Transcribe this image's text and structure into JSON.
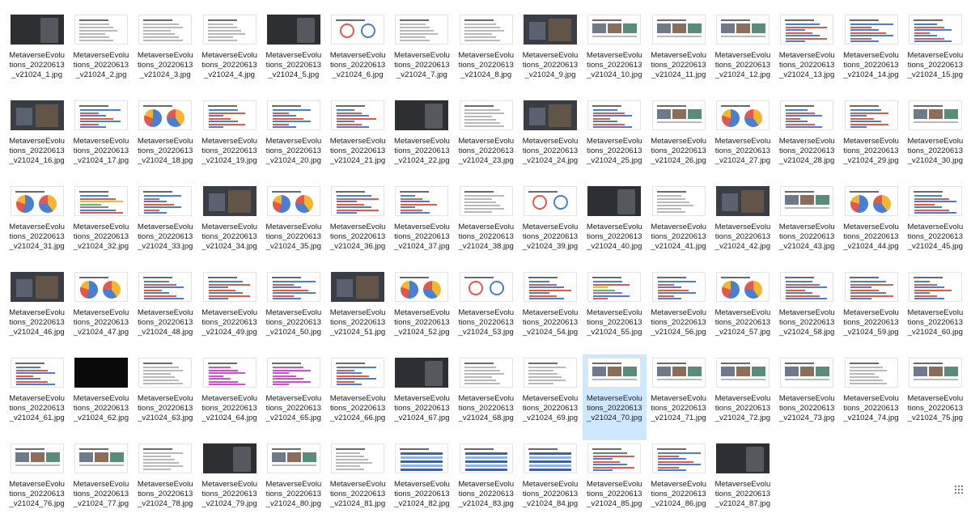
{
  "files": [
    {
      "name": "MetaverseEvolutions_20220613_v21024_1.jpg",
      "style": "dark"
    },
    {
      "name": "MetaverseEvolutions_20220613_v21024_2.jpg",
      "style": "text"
    },
    {
      "name": "MetaverseEvolutions_20220613_v21024_3.jpg",
      "style": "text"
    },
    {
      "name": "MetaverseEvolutions_20220613_v21024_4.jpg",
      "style": "text"
    },
    {
      "name": "MetaverseEvolutions_20220613_v21024_5.jpg",
      "style": "dark"
    },
    {
      "name": "MetaverseEvolutions_20220613_v21024_6.jpg",
      "style": "circles"
    },
    {
      "name": "MetaverseEvolutions_20220613_v21024_7.jpg",
      "style": "text"
    },
    {
      "name": "MetaverseEvolutions_20220613_v21024_8.jpg",
      "style": "text"
    },
    {
      "name": "MetaverseEvolutions_20220613_v21024_9.jpg",
      "style": "photo"
    },
    {
      "name": "MetaverseEvolutions_20220613_v21024_10.jpg",
      "style": "collage"
    },
    {
      "name": "MetaverseEvolutions_20220613_v21024_11.jpg",
      "style": "collage"
    },
    {
      "name": "MetaverseEvolutions_20220613_v21024_12.jpg",
      "style": "collage"
    },
    {
      "name": "MetaverseEvolutions_20220613_v21024_13.jpg",
      "style": "bars"
    },
    {
      "name": "MetaverseEvolutions_20220613_v21024_14.jpg",
      "style": "bars"
    },
    {
      "name": "MetaverseEvolutions_20220613_v21024_15.jpg",
      "style": "bars"
    },
    {
      "name": "MetaverseEvolutions_20220613_v21024_16.jpg",
      "style": "photo"
    },
    {
      "name": "MetaverseEvolutions_20220613_v21024_17.jpg",
      "style": "bars"
    },
    {
      "name": "MetaverseEvolutions_20220613_v21024_18.jpg",
      "style": "pies"
    },
    {
      "name": "MetaverseEvolutions_20220613_v21024_19.jpg",
      "style": "bars"
    },
    {
      "name": "MetaverseEvolutions_20220613_v21024_20.jpg",
      "style": "bars"
    },
    {
      "name": "MetaverseEvolutions_20220613_v21024_21.jpg",
      "style": "bars"
    },
    {
      "name": "MetaverseEvolutions_20220613_v21024_22.jpg",
      "style": "dark"
    },
    {
      "name": "MetaverseEvolutions_20220613_v21024_23.jpg",
      "style": "text"
    },
    {
      "name": "MetaverseEvolutions_20220613_v21024_24.jpg",
      "style": "photo"
    },
    {
      "name": "MetaverseEvolutions_20220613_v21024_25.jpg",
      "style": "bars"
    },
    {
      "name": "MetaverseEvolutions_20220613_v21024_26.jpg",
      "style": "collage"
    },
    {
      "name": "MetaverseEvolutions_20220613_v21024_27.jpg",
      "style": "pies"
    },
    {
      "name": "MetaverseEvolutions_20220613_v21024_28.jpg",
      "style": "bars"
    },
    {
      "name": "MetaverseEvolutions_20220613_v21024_29.jpg",
      "style": "bars"
    },
    {
      "name": "MetaverseEvolutions_20220613_v21024_30.jpg",
      "style": "collage"
    },
    {
      "name": "MetaverseEvolutions_20220613_v21024_31.jpg",
      "style": "pies"
    },
    {
      "name": "MetaverseEvolutions_20220613_v21024_32.jpg",
      "style": "colorbars"
    },
    {
      "name": "MetaverseEvolutions_20220613_v21024_33.jpg",
      "style": "bars"
    },
    {
      "name": "MetaverseEvolutions_20220613_v21024_34.jpg",
      "style": "photo"
    },
    {
      "name": "MetaverseEvolutions_20220613_v21024_35.jpg",
      "style": "pies"
    },
    {
      "name": "MetaverseEvolutions_20220613_v21024_36.jpg",
      "style": "bars"
    },
    {
      "name": "MetaverseEvolutions_20220613_v21024_37.jpg",
      "style": "bars"
    },
    {
      "name": "MetaverseEvolutions_20220613_v21024_38.jpg",
      "style": "text"
    },
    {
      "name": "MetaverseEvolutions_20220613_v21024_39.jpg",
      "style": "circles"
    },
    {
      "name": "MetaverseEvolutions_20220613_v21024_40.jpg",
      "style": "dark"
    },
    {
      "name": "MetaverseEvolutions_20220613_v21024_41.jpg",
      "style": "text"
    },
    {
      "name": "MetaverseEvolutions_20220613_v21024_42.jpg",
      "style": "photo"
    },
    {
      "name": "MetaverseEvolutions_20220613_v21024_43.jpg",
      "style": "collage"
    },
    {
      "name": "MetaverseEvolutions_20220613_v21024_44.jpg",
      "style": "pies"
    },
    {
      "name": "MetaverseEvolutions_20220613_v21024_45.jpg",
      "style": "bars"
    },
    {
      "name": "MetaverseEvolutions_20220613_v21024_46.jpg",
      "style": "photo"
    },
    {
      "name": "MetaverseEvolutions_20220613_v21024_47.jpg",
      "style": "pies"
    },
    {
      "name": "MetaverseEvolutions_20220613_v21024_48.jpg",
      "style": "bars"
    },
    {
      "name": "MetaverseEvolutions_20220613_v21024_49.jpg",
      "style": "bars"
    },
    {
      "name": "MetaverseEvolutions_20220613_v21024_50.jpg",
      "style": "bars"
    },
    {
      "name": "MetaverseEvolutions_20220613_v21024_51.jpg",
      "style": "photo"
    },
    {
      "name": "MetaverseEvolutions_20220613_v21024_52.jpg",
      "style": "pies"
    },
    {
      "name": "MetaverseEvolutions_20220613_v21024_53.jpg",
      "style": "circles"
    },
    {
      "name": "MetaverseEvolutions_20220613_v21024_54.jpg",
      "style": "bars"
    },
    {
      "name": "MetaverseEvolutions_20220613_v21024_55.jpg",
      "style": "colorbars"
    },
    {
      "name": "MetaverseEvolutions_20220613_v21024_56.jpg",
      "style": "bars"
    },
    {
      "name": "MetaverseEvolutions_20220613_v21024_57.jpg",
      "style": "pies"
    },
    {
      "name": "MetaverseEvolutions_20220613_v21024_58.jpg",
      "style": "bars"
    },
    {
      "name": "MetaverseEvolutions_20220613_v21024_59.jpg",
      "style": "bars"
    },
    {
      "name": "MetaverseEvolutions_20220613_v21024_60.jpg",
      "style": "bars"
    },
    {
      "name": "MetaverseEvolutions_20220613_v21024_61.jpg",
      "style": "bars"
    },
    {
      "name": "MetaverseEvolutions_20220613_v21024_62.jpg",
      "style": "black"
    },
    {
      "name": "MetaverseEvolutions_20220613_v21024_63.jpg",
      "style": "text"
    },
    {
      "name": "MetaverseEvolutions_20220613_v21024_64.jpg",
      "style": "magenta"
    },
    {
      "name": "MetaverseEvolutions_20220613_v21024_65.jpg",
      "style": "magenta"
    },
    {
      "name": "MetaverseEvolutions_20220613_v21024_66.jpg",
      "style": "bars"
    },
    {
      "name": "MetaverseEvolutions_20220613_v21024_67.jpg",
      "style": "dark"
    },
    {
      "name": "MetaverseEvolutions_20220613_v21024_68.jpg",
      "style": "text"
    },
    {
      "name": "MetaverseEvolutions_20220613_v21024_69.jpg",
      "style": "text"
    },
    {
      "name": "MetaverseEvolutions_20220613_v21024_70.jpg",
      "style": "collage",
      "selected": true
    },
    {
      "name": "MetaverseEvolutions_20220613_v21024_71.jpg",
      "style": "collage"
    },
    {
      "name": "MetaverseEvolutions_20220613_v21024_72.jpg",
      "style": "collage"
    },
    {
      "name": "MetaverseEvolutions_20220613_v21024_73.jpg",
      "style": "collage"
    },
    {
      "name": "MetaverseEvolutions_20220613_v21024_74.jpg",
      "style": "text"
    },
    {
      "name": "MetaverseEvolutions_20220613_v21024_75.jpg",
      "style": "collage"
    },
    {
      "name": "MetaverseEvolutions_20220613_v21024_76.jpg",
      "style": "collage"
    },
    {
      "name": "MetaverseEvolutions_20220613_v21024_77.jpg",
      "style": "collage"
    },
    {
      "name": "MetaverseEvolutions_20220613_v21024_78.jpg",
      "style": "text"
    },
    {
      "name": "MetaverseEvolutions_20220613_v21024_79.jpg",
      "style": "dark"
    },
    {
      "name": "MetaverseEvolutions_20220613_v21024_80.jpg",
      "style": "collage"
    },
    {
      "name": "MetaverseEvolutions_20220613_v21024_81.jpg",
      "style": "text"
    },
    {
      "name": "MetaverseEvolutions_20220613_v21024_82.jpg",
      "style": "bluetable"
    },
    {
      "name": "MetaverseEvolutions_20220613_v21024_83.jpg",
      "style": "bluetable"
    },
    {
      "name": "MetaverseEvolutions_20220613_v21024_84.jpg",
      "style": "bluetable"
    },
    {
      "name": "MetaverseEvolutions_20220613_v21024_85.jpg",
      "style": "bars"
    },
    {
      "name": "MetaverseEvolutions_20220613_v21024_86.jpg",
      "style": "bars"
    },
    {
      "name": "MetaverseEvolutions_20220613_v21024_87.jpg",
      "style": "dark"
    }
  ]
}
